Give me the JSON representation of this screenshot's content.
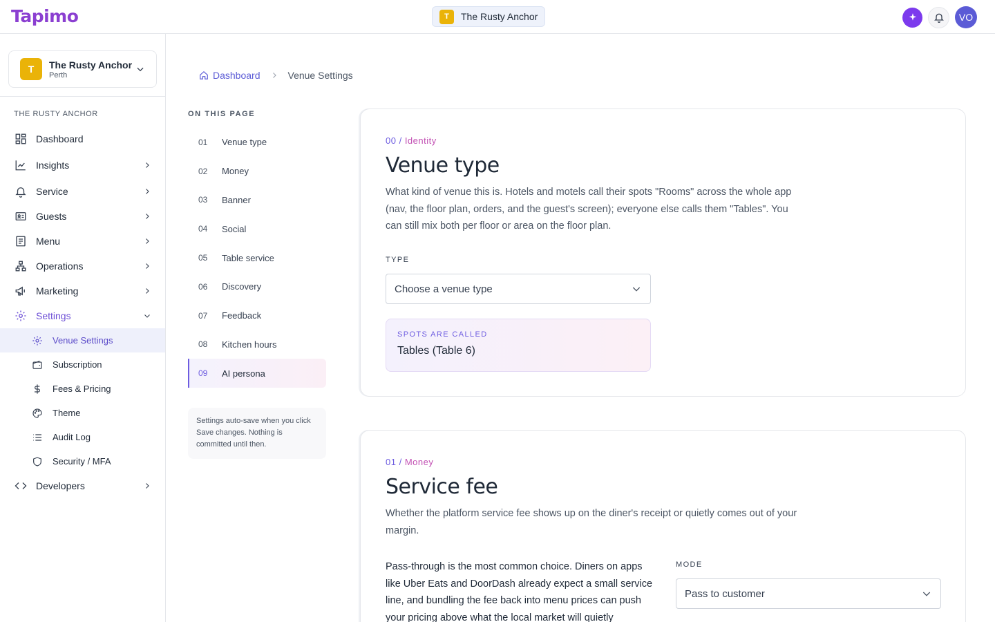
{
  "app": {
    "logo": "Tapimo",
    "current_venue": {
      "initial": "T",
      "name": "The Rusty Anchor"
    },
    "user_initials": "VO"
  },
  "sidebar": {
    "venue": {
      "initial": "T",
      "name": "The Rusty Anchor",
      "city": "Perth"
    },
    "section_label": "THE RUSTY ANCHOR",
    "items": [
      {
        "label": "Dashboard",
        "icon": "dashboard-icon"
      },
      {
        "label": "Insights",
        "icon": "chart-line-icon"
      },
      {
        "label": "Service",
        "icon": "bell-icon"
      },
      {
        "label": "Guests",
        "icon": "id-card-icon"
      },
      {
        "label": "Menu",
        "icon": "menu-doc-icon"
      },
      {
        "label": "Operations",
        "icon": "hierarchy-icon"
      },
      {
        "label": "Marketing",
        "icon": "megaphone-icon"
      },
      {
        "label": "Settings",
        "icon": "gear-icon"
      }
    ],
    "settings_sub": [
      {
        "label": "Venue Settings",
        "icon": "gear-icon"
      },
      {
        "label": "Subscription",
        "icon": "wallet-icon"
      },
      {
        "label": "Fees & Pricing",
        "icon": "dollar-icon"
      },
      {
        "label": "Theme",
        "icon": "palette-icon"
      },
      {
        "label": "Audit Log",
        "icon": "list-icon"
      },
      {
        "label": "Security / MFA",
        "icon": "shield-icon"
      }
    ],
    "developers": {
      "label": "Developers",
      "icon": "code-icon"
    }
  },
  "breadcrumb": {
    "home": "Dashboard",
    "current": "Venue Settings"
  },
  "toc": {
    "title": "ON THIS PAGE",
    "items": [
      {
        "num": "01",
        "label": "Venue type"
      },
      {
        "num": "02",
        "label": "Money"
      },
      {
        "num": "03",
        "label": "Banner"
      },
      {
        "num": "04",
        "label": "Social"
      },
      {
        "num": "05",
        "label": "Table service"
      },
      {
        "num": "06",
        "label": "Discovery"
      },
      {
        "num": "07",
        "label": "Feedback"
      },
      {
        "num": "08",
        "label": "Kitchen hours"
      },
      {
        "num": "09",
        "label": "AI persona"
      }
    ],
    "note": "Settings auto-save when you click Save changes. Nothing is committed until then."
  },
  "identity": {
    "eyebrow_num": "00 /",
    "eyebrow_label": "Identity",
    "title": "Venue type",
    "description": "What kind of venue this is. Hotels and motels call their spots \"Rooms\" across the whole app (nav, the floor plan, orders, and the guest's screen); everyone else calls them \"Tables\". You can still mix both per floor or area on the floor plan.",
    "type_label": "TYPE",
    "type_placeholder": "Choose a venue type",
    "spots_label": "SPOTS ARE CALLED",
    "spots_value": "Tables (Table 6)"
  },
  "money": {
    "eyebrow_num": "01 /",
    "eyebrow_label": "Money",
    "title": "Service fee",
    "description": "Whether the platform service fee shows up on the diner's receipt or quietly comes out of your margin.",
    "body": "Pass-through is the most common choice. Diners on apps like Uber Eats and DoorDash already expect a small service line, and bundling the fee back into menu prices can push your pricing above what the local market will quietly",
    "mode_label": "MODE",
    "mode_value": "Pass to customer"
  }
}
